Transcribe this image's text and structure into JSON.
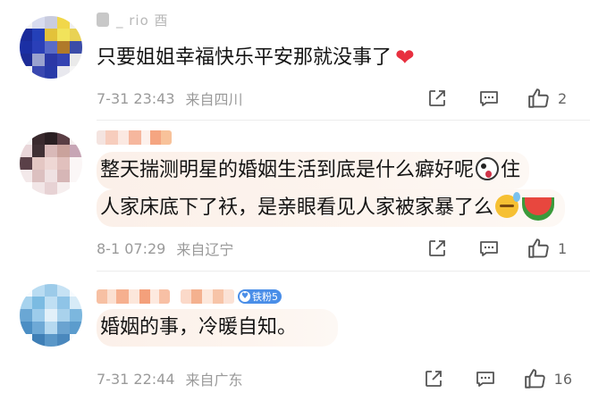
{
  "comments": [
    {
      "username_visible": "_ rio 酉",
      "text": "只要姐姐幸福快乐平安那就没事了",
      "emoji": "red-heart",
      "time": "7-31 23:43",
      "location": "来自四川",
      "like_count": "2"
    },
    {
      "text_line1": "整天揣测明星的婚姻生活到底是什么癖好呢",
      "text_line1_end": "住",
      "text_line2": "人家床底下了袄，是亲眼看见人家被家暴了么",
      "emoji_1": "shocked-face",
      "emoji_2": "sweat-smile-face",
      "emoji_3": "watermelon",
      "time": "8-1 07:29",
      "location": "来自辽宁",
      "like_count": "1"
    },
    {
      "badge": "铁粉5",
      "text": "婚姻的事，冷暖自知。",
      "time": "7-31 22:44",
      "location": "来自广东",
      "like_count": "16"
    }
  ],
  "colors": {
    "meta_gray": "#9a9a9a",
    "highlight_bg": "#fbf0e9",
    "badge_blue": "#4a8ee8",
    "heart_red": "#e8303f"
  }
}
